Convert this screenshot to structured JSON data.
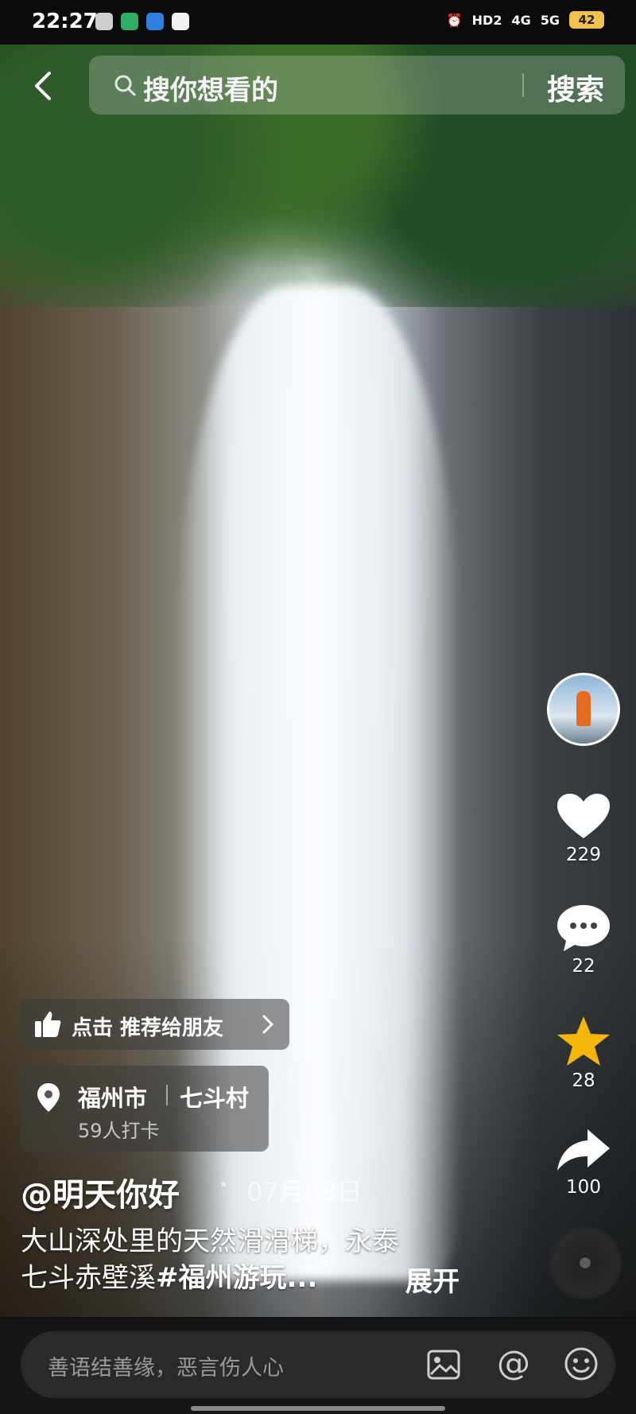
{
  "status_bar": {
    "time": "22:27",
    "indicators": [
      "HD2",
      "4G",
      "5G"
    ],
    "battery": "42"
  },
  "search": {
    "placeholder": "搜你想看的",
    "button_label": "搜索"
  },
  "actions": {
    "like_count": "229",
    "comment_count": "22",
    "favorite_count": "28",
    "share_count": "100"
  },
  "recommend": {
    "label": "点击 推荐给朋友"
  },
  "location": {
    "city": "福州市",
    "place": "七斗村",
    "checkins": "59人打卡"
  },
  "post": {
    "author": "@明天你好",
    "date": "07月08日",
    "caption_line1": "大山深处里的天然滑滑梯，永泰",
    "caption_line2_plain": "七斗赤壁溪",
    "caption_line2_tag": "#福州游玩...",
    "expand_label": "展开"
  },
  "comment_bar": {
    "placeholder": "善语结善缘，恶言伤人心"
  },
  "colors": {
    "like": "#ffffff",
    "favorite": "#f5b50a",
    "battery": "#f2c14e"
  }
}
